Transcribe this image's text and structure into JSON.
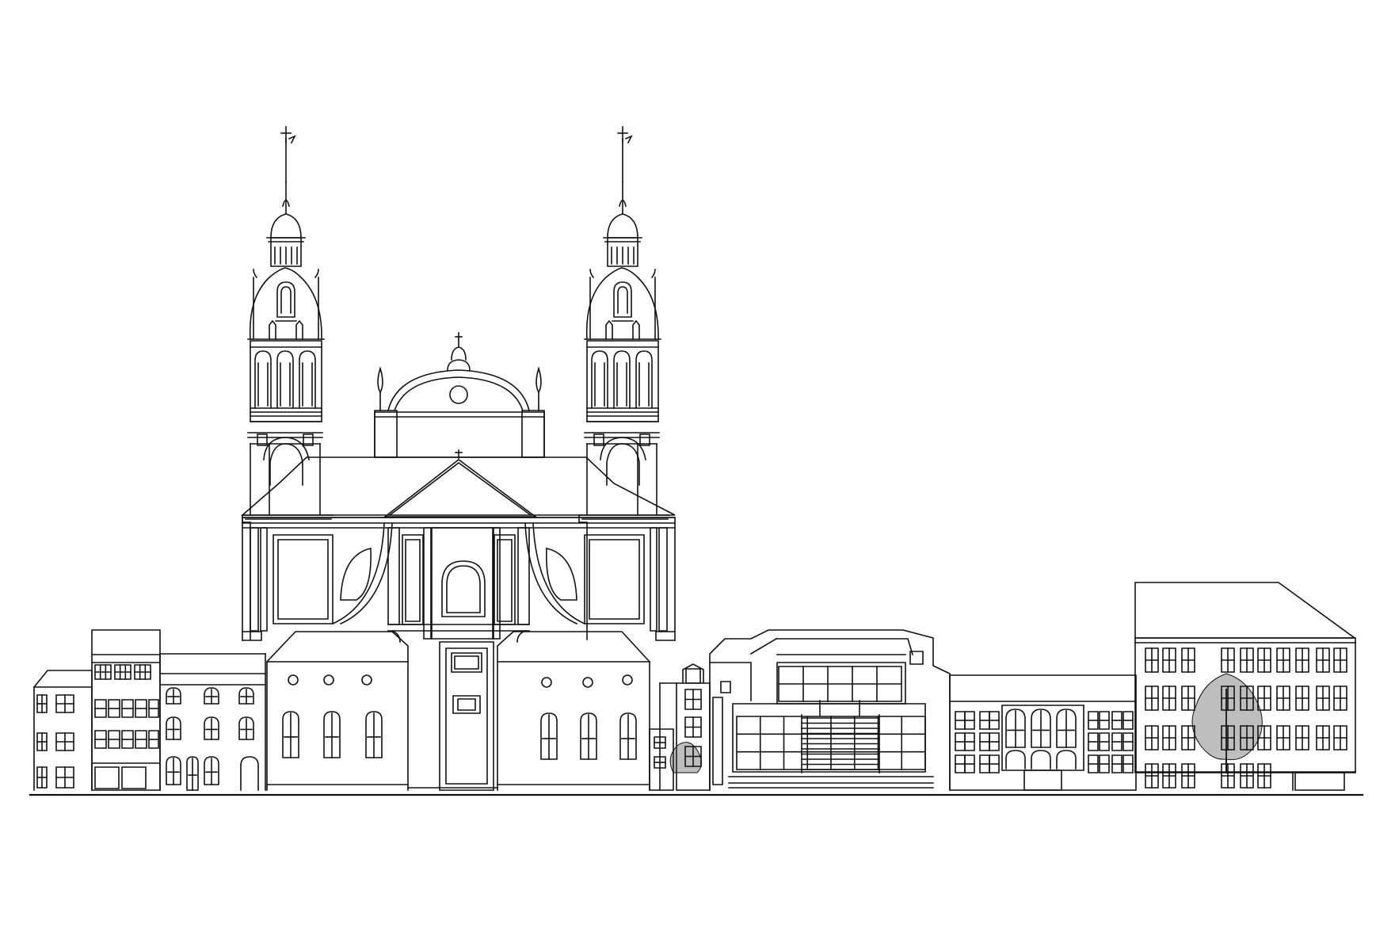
{
  "drawing": {
    "background": "#ffffff",
    "ink": "#111111",
    "tree_fill": "#444444"
  }
}
